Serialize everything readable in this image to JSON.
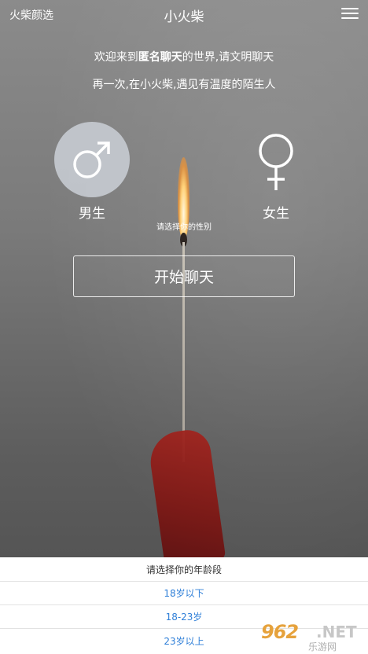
{
  "header": {
    "brand": "火柴颜选",
    "title": "小火柴",
    "menu_icon": "hamburger-menu-icon"
  },
  "welcome": {
    "prefix": "欢迎来到",
    "highlight": "匿名聊天",
    "suffix": "的世界,请文明聊天",
    "subline": "再一次,在小火柴,遇见有温度的陌生人"
  },
  "gender": {
    "male": {
      "label": "男生",
      "icon": "male-symbol-icon",
      "selected": true
    },
    "female": {
      "label": "女生",
      "icon": "female-symbol-icon",
      "selected": false
    },
    "prompt": "请选择你的性别"
  },
  "start_button": {
    "label": "开始聊天"
  },
  "age_sheet": {
    "title": "请选择你的年龄段",
    "options": [
      "18岁以下",
      "18-23岁",
      "23岁以上"
    ]
  },
  "watermark": {
    "number": "962",
    "suffix": ".NET",
    "sub": "乐游网"
  },
  "colors": {
    "accent": "#2f7fd8",
    "selected_circle": "#c8cdd4"
  }
}
